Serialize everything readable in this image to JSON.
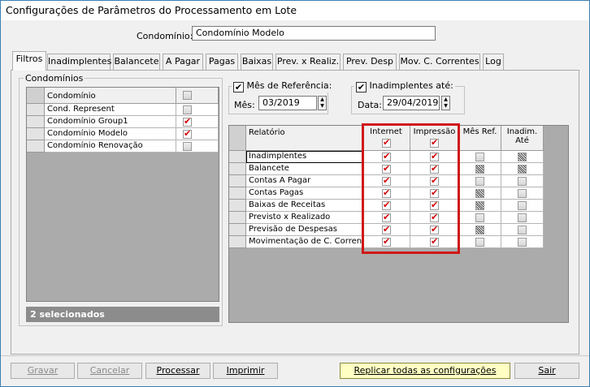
{
  "window": {
    "title": "Configurações de Parâmetros do Processamento em Lote"
  },
  "header": {
    "condominio_label": "Condomínio:",
    "condominio_value": "Condomínio Modelo"
  },
  "tabs": [
    "Filtros",
    "Inadimplentes",
    "Balancete",
    "A Pagar",
    "Pagas",
    "Baixas",
    "Prev. x Realiz.",
    "Prev. Desp",
    "Mov. C. Correntes",
    "Log"
  ],
  "condominios": {
    "group_title": "Condomínios",
    "column": "Condomínio",
    "rows": [
      {
        "name": "Cond. Represent",
        "checked": false
      },
      {
        "name": "Condomínio Group1",
        "checked": true
      },
      {
        "name": "Condomínio Modelo",
        "checked": true
      },
      {
        "name": "Condomínio Renovação",
        "checked": false
      }
    ],
    "status": "2 selecionados"
  },
  "mes_referencia": {
    "title": "Mês de Referência:",
    "checked": true,
    "label": "Mês:",
    "value": "03/2019"
  },
  "inadimplentes_ate": {
    "title": "Inadimplentes até:",
    "checked": true,
    "label": "Data:",
    "value": "29/04/2019"
  },
  "relatorios": {
    "columns": {
      "relatorio": "Relatório",
      "internet": "Internet",
      "impressao": "Impressão",
      "mes_ref": "Mês Ref.",
      "inadim_ate": "Inadim. Até"
    },
    "header_internet": "checked",
    "header_impressao": "checked",
    "rows": [
      {
        "name": "Inadimplentes",
        "internet": "checked",
        "impressao": "checked",
        "mes_ref": "off",
        "inadim_ate": "partial"
      },
      {
        "name": "Balancete",
        "internet": "checked",
        "impressao": "checked",
        "mes_ref": "partial",
        "inadim_ate": "partial"
      },
      {
        "name": "Contas A Pagar",
        "internet": "checked",
        "impressao": "checked",
        "mes_ref": "off",
        "inadim_ate": "off"
      },
      {
        "name": "Contas Pagas",
        "internet": "checked",
        "impressao": "checked",
        "mes_ref": "partial",
        "inadim_ate": "off"
      },
      {
        "name": "Baixas de Receitas",
        "internet": "checked",
        "impressao": "checked",
        "mes_ref": "partial",
        "inadim_ate": "off"
      },
      {
        "name": "Previsto x Realizado",
        "internet": "checked",
        "impressao": "checked",
        "mes_ref": "off",
        "inadim_ate": "off"
      },
      {
        "name": "Previsão de Despesas",
        "internet": "checked",
        "impressao": "checked",
        "mes_ref": "partial",
        "inadim_ate": "off"
      },
      {
        "name": "Movimentação de C. Corrente",
        "internet": "checked",
        "impressao": "checked",
        "mes_ref": "off",
        "inadim_ate": "off"
      }
    ]
  },
  "buttons": {
    "gravar": "Gravar",
    "cancelar": "Cancelar",
    "processar": "Processar",
    "imprimir": "Imprimir",
    "replicar": "Replicar todas as configurações",
    "sair": "Sair"
  },
  "colors": {
    "check_red": "#d40000",
    "highlight_border": "#d01818",
    "replicar_bg": "#ffffc4",
    "status_bar": "#8c8c8c"
  }
}
